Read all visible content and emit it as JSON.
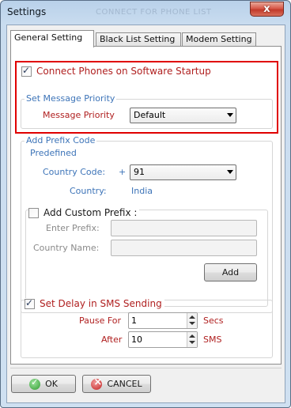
{
  "window": {
    "title": "Settings",
    "ghost_title": "CONNECT FOR PHONE LIST",
    "close_symbol": "x"
  },
  "tabs": [
    {
      "label": "General Setting",
      "active": true
    },
    {
      "label": "Black List Setting",
      "active": false
    },
    {
      "label": "Modem Setting",
      "active": false
    }
  ],
  "general": {
    "connect_on_startup": {
      "label": "Connect Phones on Software Startup",
      "checked": true
    },
    "message_priority_group": {
      "title": "Set Message Priority",
      "label": "Message Priority",
      "value": "Default"
    },
    "prefix_group": {
      "title": "Add Prefix Code",
      "predefined_title": "Predefined",
      "country_code_label": "Country Code:",
      "plus": "+",
      "country_code_value": "91",
      "country_label": "Country:",
      "country_value": "India",
      "custom_prefix": {
        "label": "Add Custom Prefix :",
        "checked": false
      },
      "enter_prefix_label": "Enter Prefix:",
      "enter_prefix_value": "",
      "country_name_label": "Country Name:",
      "country_name_value": "",
      "add_button": "Add"
    },
    "delay_group": {
      "label": "Set Delay in SMS Sending",
      "checked": true,
      "pause_label": "Pause For",
      "pause_value": "1",
      "pause_unit": "Secs",
      "after_label": "After",
      "after_value": "10",
      "after_unit": "SMS"
    }
  },
  "footer": {
    "ok_label": "OK",
    "cancel_label": "CANCEL"
  },
  "colors": {
    "highlight": "#e00000",
    "label_red": "#b02020",
    "label_blue": "#3d74b8"
  }
}
